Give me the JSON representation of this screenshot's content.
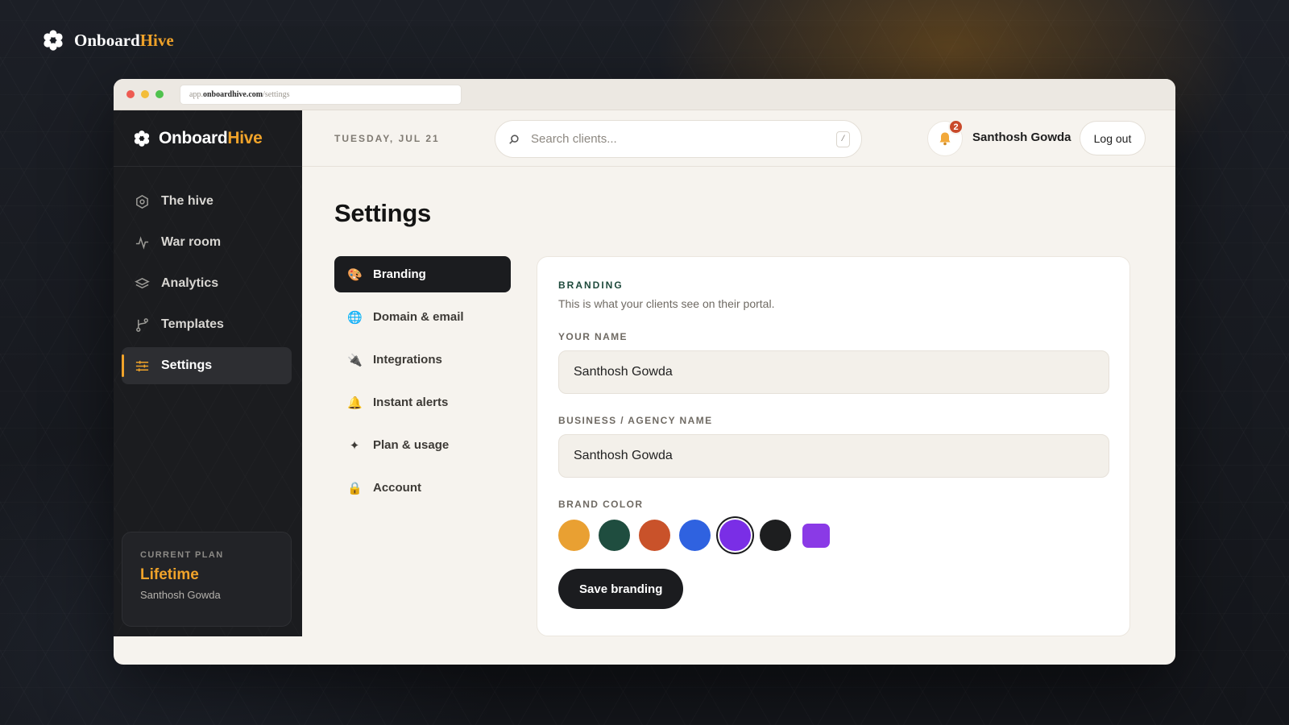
{
  "brand": {
    "prefix": "Onboard",
    "accent": "Hive",
    "accent_color": "#f0a32a"
  },
  "browser": {
    "url_prefix": "app.",
    "url_domain": "onboardhive.com",
    "url_path": "/settings"
  },
  "sidebar": {
    "items": [
      {
        "label": "The hive",
        "icon": "hexagon-icon",
        "active": false
      },
      {
        "label": "War room",
        "icon": "activity-icon",
        "active": false
      },
      {
        "label": "Analytics",
        "icon": "layers-icon",
        "active": false
      },
      {
        "label": "Templates",
        "icon": "branch-icon",
        "active": false
      },
      {
        "label": "Settings",
        "icon": "sliders-icon",
        "active": true
      }
    ],
    "plan": {
      "label": "CURRENT PLAN",
      "value": "Lifetime",
      "owner": "Santhosh Gowda"
    }
  },
  "header": {
    "date": "TUESDAY, JUL 21",
    "search_placeholder": "Search clients...",
    "search_shortcut": "/",
    "notification_count": "2",
    "user_name": "Santhosh Gowda",
    "logout_label": "Log out"
  },
  "page": {
    "title": "Settings"
  },
  "settings_nav": {
    "items": [
      {
        "label": "Branding",
        "icon": "palette-icon",
        "glyph": "🎨",
        "active": true
      },
      {
        "label": "Domain & email",
        "icon": "globe-icon",
        "glyph": "🌐",
        "active": false
      },
      {
        "label": "Integrations",
        "icon": "plug-icon",
        "glyph": "🔌",
        "active": false
      },
      {
        "label": "Instant alerts",
        "icon": "bell-icon",
        "glyph": "🔔",
        "active": false
      },
      {
        "label": "Plan & usage",
        "icon": "sparkle-icon",
        "glyph": "✦",
        "active": false
      },
      {
        "label": "Account",
        "icon": "lock-icon",
        "glyph": "🔒",
        "active": false
      }
    ]
  },
  "branding": {
    "title": "BRANDING",
    "description": "This is what your clients see on their portal.",
    "name_label": "YOUR NAME",
    "name_value": "Santhosh Gowda",
    "business_label": "BUSINESS / AGENCY NAME",
    "business_value": "Santhosh Gowda",
    "color_label": "BRAND COLOR",
    "colors": [
      "#e9a032",
      "#1f4d3f",
      "#c9522a",
      "#2f62e0",
      "#7a2ee6",
      "#1d1e1f"
    ],
    "selected_color_index": 4,
    "custom_color": "#8a3ae6",
    "save_label": "Save branding"
  }
}
